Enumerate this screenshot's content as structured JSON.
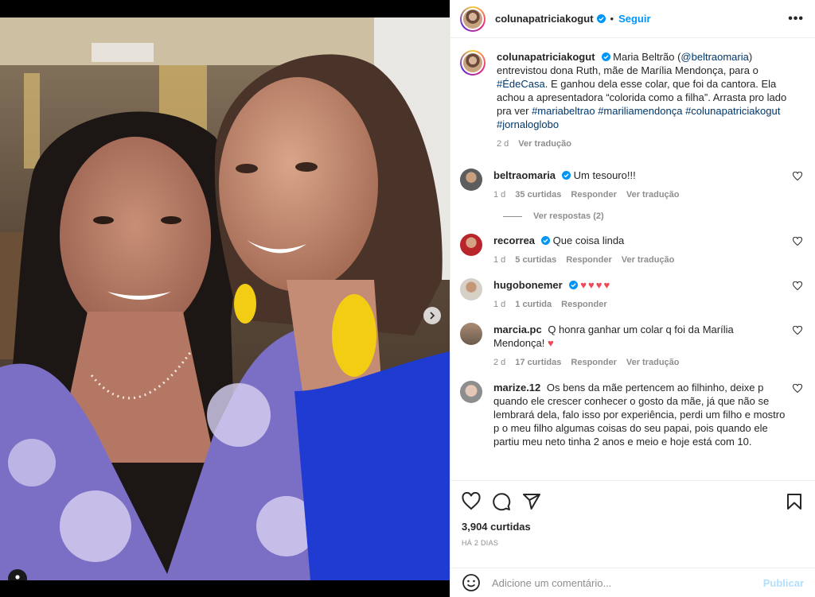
{
  "post": {
    "author": "colunapatriciakogut",
    "follow_label": "Seguir",
    "separator": "•",
    "more_label": "•••",
    "caption_prefix": "Maria Beltrão (",
    "caption_mention": "@beltraomaria",
    "caption_mid1": ") entrevistou dona Ruth, mãe de Marília Mendonça, para o ",
    "caption_tag1": "#ÉdeCasa",
    "caption_mid2": ". E ganhou dela esse colar, que foi da cantora. Ela achou a apresentadora “colorida como a filha”. Arrasta pro lado pra ver ",
    "caption_tag2": "#mariabeltrao",
    "caption_tag3": "#mariliamendonça",
    "caption_tag4": "#colunapatriciakogut",
    "caption_tag5": "#jornaloglobo",
    "caption_time": "2 d",
    "caption_translate": "Ver tradução",
    "likes": "3,904 curtidas",
    "ago": "HÁ 2 DIAS",
    "comment_placeholder": "Adicione um comentário...",
    "publish_label": "Publicar"
  },
  "comments": [
    {
      "user": "beltraomaria",
      "text": "Um tesouro!!!",
      "time": "1 d",
      "likes": "35 curtidas",
      "reply": "Responder",
      "translate": "Ver tradução",
      "replies": "Ver respostas (2)"
    },
    {
      "user": "recorrea",
      "text": "Que coisa linda",
      "time": "1 d",
      "likes": "5 curtidas",
      "reply": "Responder",
      "translate": "Ver tradução"
    },
    {
      "user": "hugobonemer",
      "text": "♥♥♥♥",
      "time": "1 d",
      "likes": "1 curtida",
      "reply": "Responder"
    },
    {
      "user": "marcia.pc",
      "text": "Q honra ganhar um colar q foi da Marília Mendonça!",
      "text2": "♥",
      "time": "2 d",
      "likes": "17 curtidas",
      "reply": "Responder",
      "translate": "Ver tradução"
    },
    {
      "user": "marize.12",
      "text": "Os bens da mãe pertencem ao filhinho, deixe p quando ele crescer conhecer o gosto da mãe, já que não se lembrará dela, falo isso por experiência, perdi um filho e mostro p o meu filho algumas coisas do seu papai, pois quando ele partiu meu neto tinha 2 anos e meio e hoje está com 10."
    }
  ],
  "colors": {
    "link": "#00376b",
    "follow": "#0095f6",
    "verified": "#0095f6",
    "muted": "#8e8e8e",
    "heart_red": "#ed4956"
  }
}
